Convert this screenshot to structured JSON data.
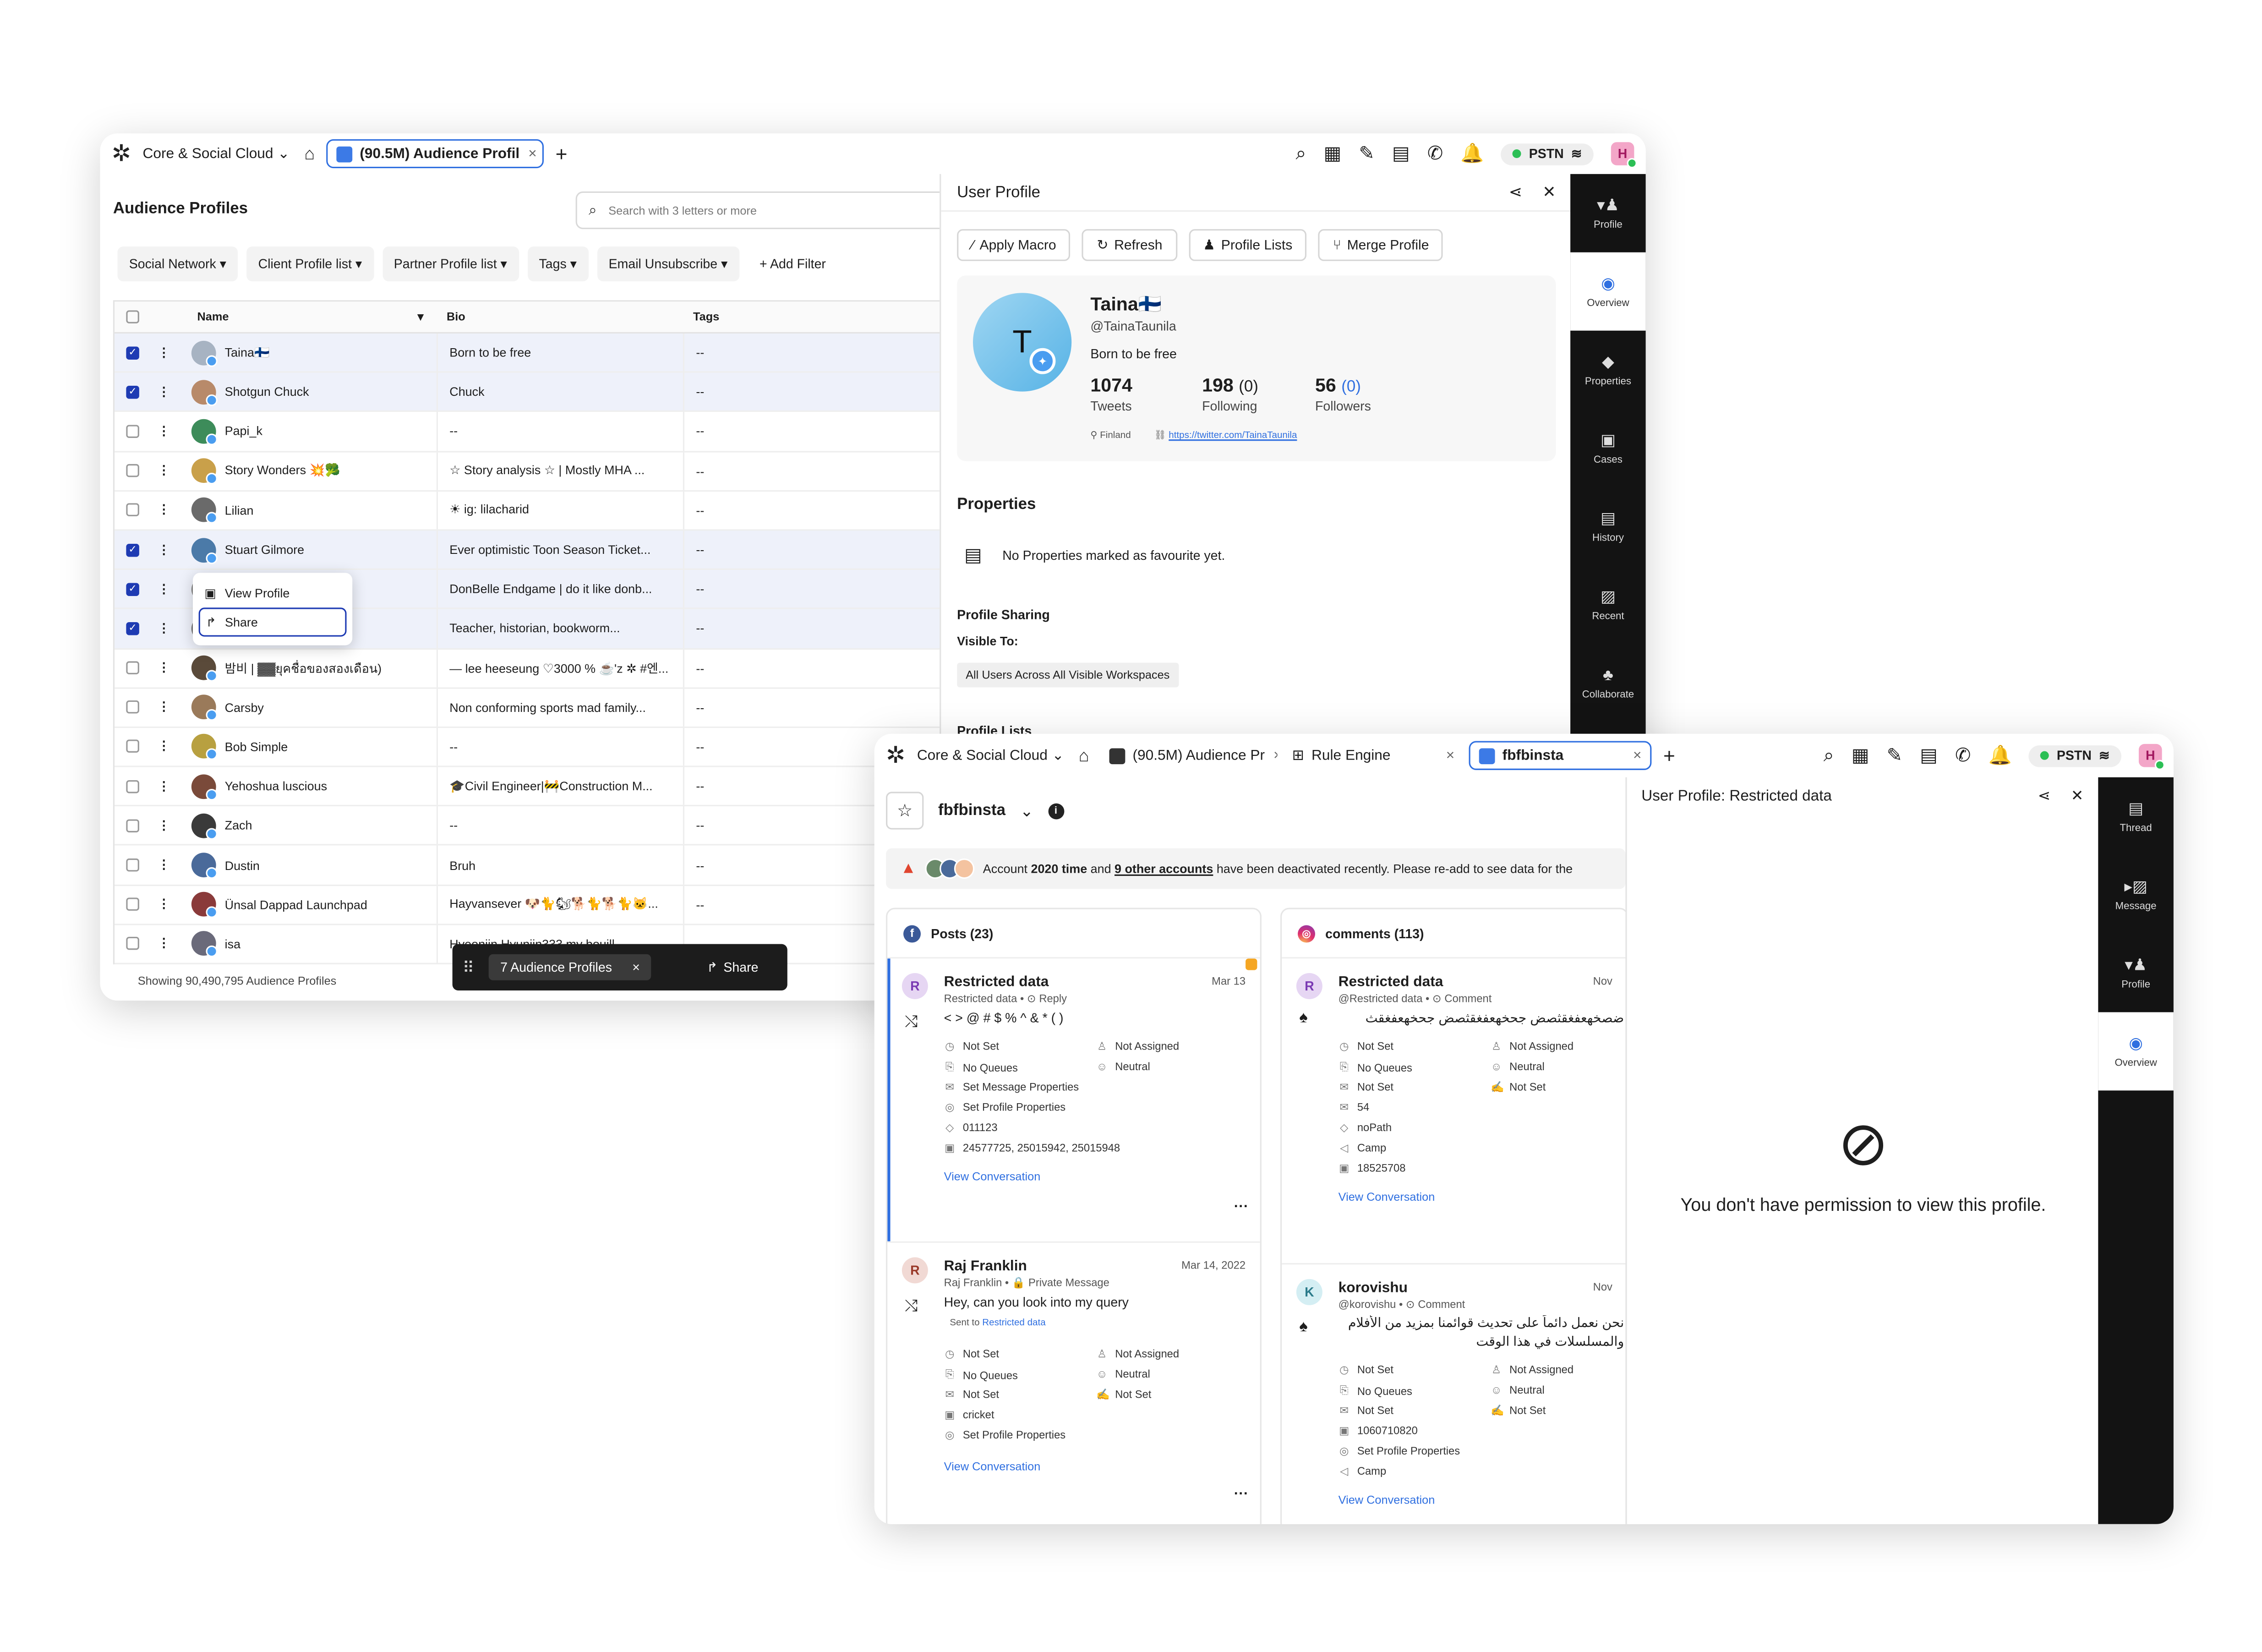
{
  "w1": {
    "workspace": "Core & Social Cloud",
    "tab_label": "(90.5M) Audience Profil",
    "pstn": "PSTN",
    "avatar": "H",
    "title": "Audience Profiles",
    "search_placeholder": "Search with 3 letters or more",
    "filters": [
      "Social Network",
      "Client Profile list",
      "Partner Profile list",
      "Tags",
      "Email Unsubscribe"
    ],
    "add_filter": "+ Add Filter",
    "columns": {
      "name": "Name",
      "bio": "Bio",
      "tags": "Tags"
    },
    "rows": [
      {
        "name": "Taina🇫🇮",
        "bio": "Born to be free",
        "tags": "--",
        "checked": true,
        "color": "#a7b3c2"
      },
      {
        "name": "Shotgun Chuck",
        "bio": "Chuck",
        "tags": "--",
        "checked": true,
        "color": "#b88a6a"
      },
      {
        "name": "Papi_k",
        "bio": "--",
        "tags": "--",
        "checked": false,
        "color": "#3d8c5a"
      },
      {
        "name": "Story Wonders 💥🥦",
        "bio": "☆ Story analysis ☆ | Mostly MHA ...",
        "tags": "--",
        "checked": false,
        "color": "#c9a04a"
      },
      {
        "name": "Lilian",
        "bio": "☀ ig: lilacharid",
        "tags": "--",
        "checked": false,
        "color": "#6a6a6a"
      },
      {
        "name": "Stuart Gilmore",
        "bio": "Ever optimistic Toon Season Ticket...",
        "tags": "--",
        "checked": true,
        "color": "#4b7aa8"
      },
      {
        "name": "",
        "bio": "DonBelle Endgame | do it like donb...",
        "tags": "--",
        "checked": true,
        "color": "#888"
      },
      {
        "name": "",
        "bio": "Teacher, historian, bookworm...",
        "tags": "--",
        "checked": true,
        "color": "#777"
      },
      {
        "name": "밤비 | ▓▓ยุคชื่อของสองเดือน)",
        "bio": "— lee heeseung ♡3000 % ☕'z ✲ #엔...",
        "tags": "--",
        "checked": false,
        "color": "#5a4a3a"
      },
      {
        "name": "Carsby",
        "bio": "Non conforming sports mad family...",
        "tags": "--",
        "checked": false,
        "color": "#9a7a5a"
      },
      {
        "name": "Bob Simple",
        "bio": "--",
        "tags": "--",
        "checked": false,
        "color": "#b8a040"
      },
      {
        "name": "Yehoshua luscious",
        "bio": "🎓Civil Engineer|🚧Construction M...",
        "tags": "--",
        "checked": false,
        "color": "#7a4a3a"
      },
      {
        "name": "Zach",
        "bio": "--",
        "tags": "--",
        "checked": false,
        "color": "#3a3a3a"
      },
      {
        "name": "Dustin",
        "bio": "Bruh",
        "tags": "--",
        "checked": false,
        "color": "#4a6a9a"
      },
      {
        "name": "Ünsal Dappad Launchpad",
        "bio": "Hayvansever 🐶🐈🐿🐕🐈🐕🐈🐱...",
        "tags": "--",
        "checked": false,
        "color": "#8a3a3a"
      },
      {
        "name": "isa",
        "bio": "Hyeonjin Hyunjin333 my bouill",
        "tags": "--",
        "checked": false,
        "color": "#6a6a7a"
      }
    ],
    "context_menu": {
      "view": "View Profile",
      "share": "Share"
    },
    "footer": "Showing 90,490,795 Audience Profiles",
    "bulk": {
      "count": "7 Audience Profiles",
      "share": "Share"
    },
    "profile": {
      "header": "User Profile",
      "buttons": [
        "Apply Macro",
        "Refresh",
        "Profile Lists",
        "Merge Profile"
      ],
      "initial": "T",
      "name": "Taina🇫🇮",
      "handle": "@TainaTaunila",
      "bio": "Born to be free",
      "tweets": "1074",
      "tweets_label": "Tweets",
      "following": "198",
      "following_paren": "(0)",
      "following_label": "Following",
      "followers": "56",
      "followers_paren": "(0)",
      "followers_label": "Followers",
      "location": "Finland",
      "url": "https://twitter.com/TainaTaunila",
      "properties_title": "Properties",
      "no_props": "No Properties marked as favourite yet.",
      "sharing_title": "Profile Sharing",
      "visible_to": "Visible To:",
      "visible_chip": "All Users Across All Visible Workspaces",
      "lists_title": "Profile Lists"
    },
    "rail": [
      "Profile",
      "Overview",
      "Properties",
      "Cases",
      "History",
      "Recent",
      "Collaborate"
    ]
  },
  "w2": {
    "workspace": "Core & Social Cloud",
    "tabs": [
      "(90.5M) Audience Pr",
      "Rule Engine",
      "fbfbinsta"
    ],
    "pstn": "PSTN",
    "avatar": "H",
    "account": "fbfbinsta",
    "banner": {
      "a": "Account ",
      "b": "2020 time",
      "c": " and ",
      "d": "9 other accounts",
      "e": " have been deactivated recently. Please re-add to see data for the"
    },
    "posts_title": "Posts (23)",
    "comments_title": "comments (113)",
    "p1": {
      "title": "Restricted data",
      "date": "Mar 13",
      "sub": "Restricted data • ⊙ Reply",
      "msg": "< > @ # $ % ^ & * ( )",
      "left": [
        "Not Set",
        "No Queues",
        "Set Message Properties",
        "Set Profile Properties",
        "011123",
        "24577725, 25015942, 25015948"
      ],
      "right": [
        "Not Assigned",
        "Neutral"
      ],
      "vc": "View Conversation"
    },
    "p2": {
      "title": "Raj Franklin",
      "date": "Mar 14, 2022",
      "sub": "Raj Franklin • 🔒 Private Message",
      "msg": "Hey, can you look into my query",
      "sent": "Sent to ",
      "sent_link": "Restricted data",
      "left": [
        "Not Set",
        "No Queues",
        "Not Set",
        "cricket",
        "Set Profile Properties"
      ],
      "right": [
        "Not Assigned",
        "Neutral",
        "Not Set"
      ],
      "vc": "View Conversation"
    },
    "c1": {
      "title": "Restricted data",
      "date": "Nov",
      "sub": "@Restricted data • ⊙ Comment",
      "msg": "ضصخهعفغقثصض جحخهعفغقثصض جحخهعفغقث",
      "left": [
        "Not Set",
        "No Queues",
        "Not Set",
        "54",
        "noPath",
        "Camp",
        "18525708"
      ],
      "right": [
        "Not Assigned",
        "Neutral",
        "Not Set"
      ],
      "vc": "View Conversation"
    },
    "c2": {
      "title": "korovishu",
      "date": "Nov",
      "sub": "@korovishu • ⊙ Comment",
      "msg1": "نحن نعمل دائماً على تحديث قوائمنا بمزيد من الأفلام",
      "msg2": "والمسلسلات في هذا الوقت",
      "left": [
        "Not Set",
        "No Queues",
        "Not Set",
        "1060710820",
        "Set Profile Properties",
        "Camp"
      ],
      "right": [
        "Not Assigned",
        "Neutral",
        "Not Set"
      ],
      "vc": "View Conversation"
    },
    "restricted": {
      "header": "User Profile: Restricted data",
      "msg": "You don't have permission to view this profile."
    },
    "rail": [
      "Thread",
      "Message",
      "Profile",
      "Overview"
    ]
  }
}
